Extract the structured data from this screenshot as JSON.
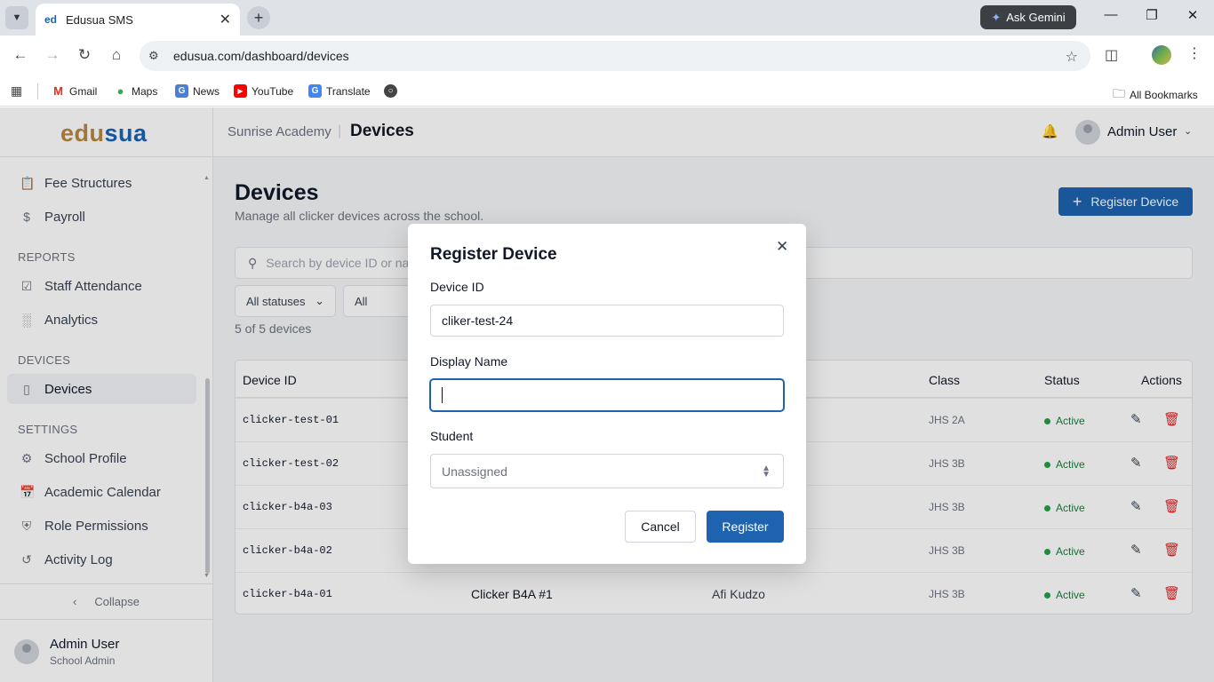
{
  "browser": {
    "tab_title": "Edusua SMS",
    "favicon_text": "ed",
    "url": "edusua.com/dashboard/devices",
    "gemini_label": "Ask Gemini",
    "bookmarks": [
      "Gmail",
      "Maps",
      "News",
      "YouTube",
      "Translate"
    ],
    "all_bookmarks": "All Bookmarks"
  },
  "app": {
    "logo_part1": "edu",
    "logo_part2": "sua",
    "school_name": "Sunrise Academy",
    "breadcrumb_page": "Devices",
    "top_user": "Admin User"
  },
  "sidebar": {
    "items_top": [
      {
        "label": "Fee Structures",
        "icon": "clipboard-icon"
      },
      {
        "label": "Payroll",
        "icon": "dollar-icon"
      }
    ],
    "section_reports": "REPORTS",
    "items_reports": [
      {
        "label": "Staff Attendance",
        "icon": "clipboard-check-icon"
      },
      {
        "label": "Analytics",
        "icon": "bar-chart-icon"
      }
    ],
    "section_devices": "DEVICES",
    "items_devices": [
      {
        "label": "Devices",
        "icon": "tablet-icon",
        "active": true
      }
    ],
    "section_settings": "SETTINGS",
    "items_settings": [
      {
        "label": "School Profile",
        "icon": "gear-icon"
      },
      {
        "label": "Academic Calendar",
        "icon": "calendar-icon"
      },
      {
        "label": "Role Permissions",
        "icon": "shield-icon"
      },
      {
        "label": "Activity Log",
        "icon": "history-icon"
      }
    ],
    "collapse_label": "Collapse",
    "user_name": "Admin User",
    "user_role": "School Admin"
  },
  "main": {
    "title": "Devices",
    "subtitle": "Manage all clicker devices across the school.",
    "register_button": "Register Device",
    "search_placeholder": "Search by device ID or na",
    "filter_status": "All statuses",
    "filter_other": "All",
    "count_text": "5 of 5 devices",
    "columns": {
      "device_id": "Device ID",
      "class": "Class",
      "status": "Status",
      "actions": "Actions"
    },
    "rows": [
      {
        "device_id": "clicker-test-01",
        "name": "",
        "student": "",
        "class": "JHS 2A",
        "status": "Active"
      },
      {
        "device_id": "clicker-test-02",
        "name": "",
        "student": "",
        "class": "JHS 3B",
        "status": "Active"
      },
      {
        "device_id": "clicker-b4a-03",
        "name": "",
        "student": "",
        "class": "JHS 3B",
        "status": "Active"
      },
      {
        "device_id": "clicker-b4a-02",
        "name": "",
        "student": "",
        "class": "JHS 3B",
        "status": "Active"
      },
      {
        "device_id": "clicker-b4a-01",
        "name": "Clicker B4A #1",
        "student": "Afi Kudzo",
        "class": "JHS 3B",
        "status": "Active"
      }
    ]
  },
  "modal": {
    "title": "Register Device",
    "device_id_label": "Device ID",
    "device_id_value": "cliker-test-24",
    "display_name_label": "Display Name",
    "display_name_value": "",
    "student_label": "Student",
    "student_value": "Unassigned",
    "cancel": "Cancel",
    "submit": "Register"
  },
  "colors": {
    "primary": "#1e63b0",
    "logo_gold": "#b88743",
    "active_green": "#15803d",
    "delete_red": "#dc2626"
  }
}
